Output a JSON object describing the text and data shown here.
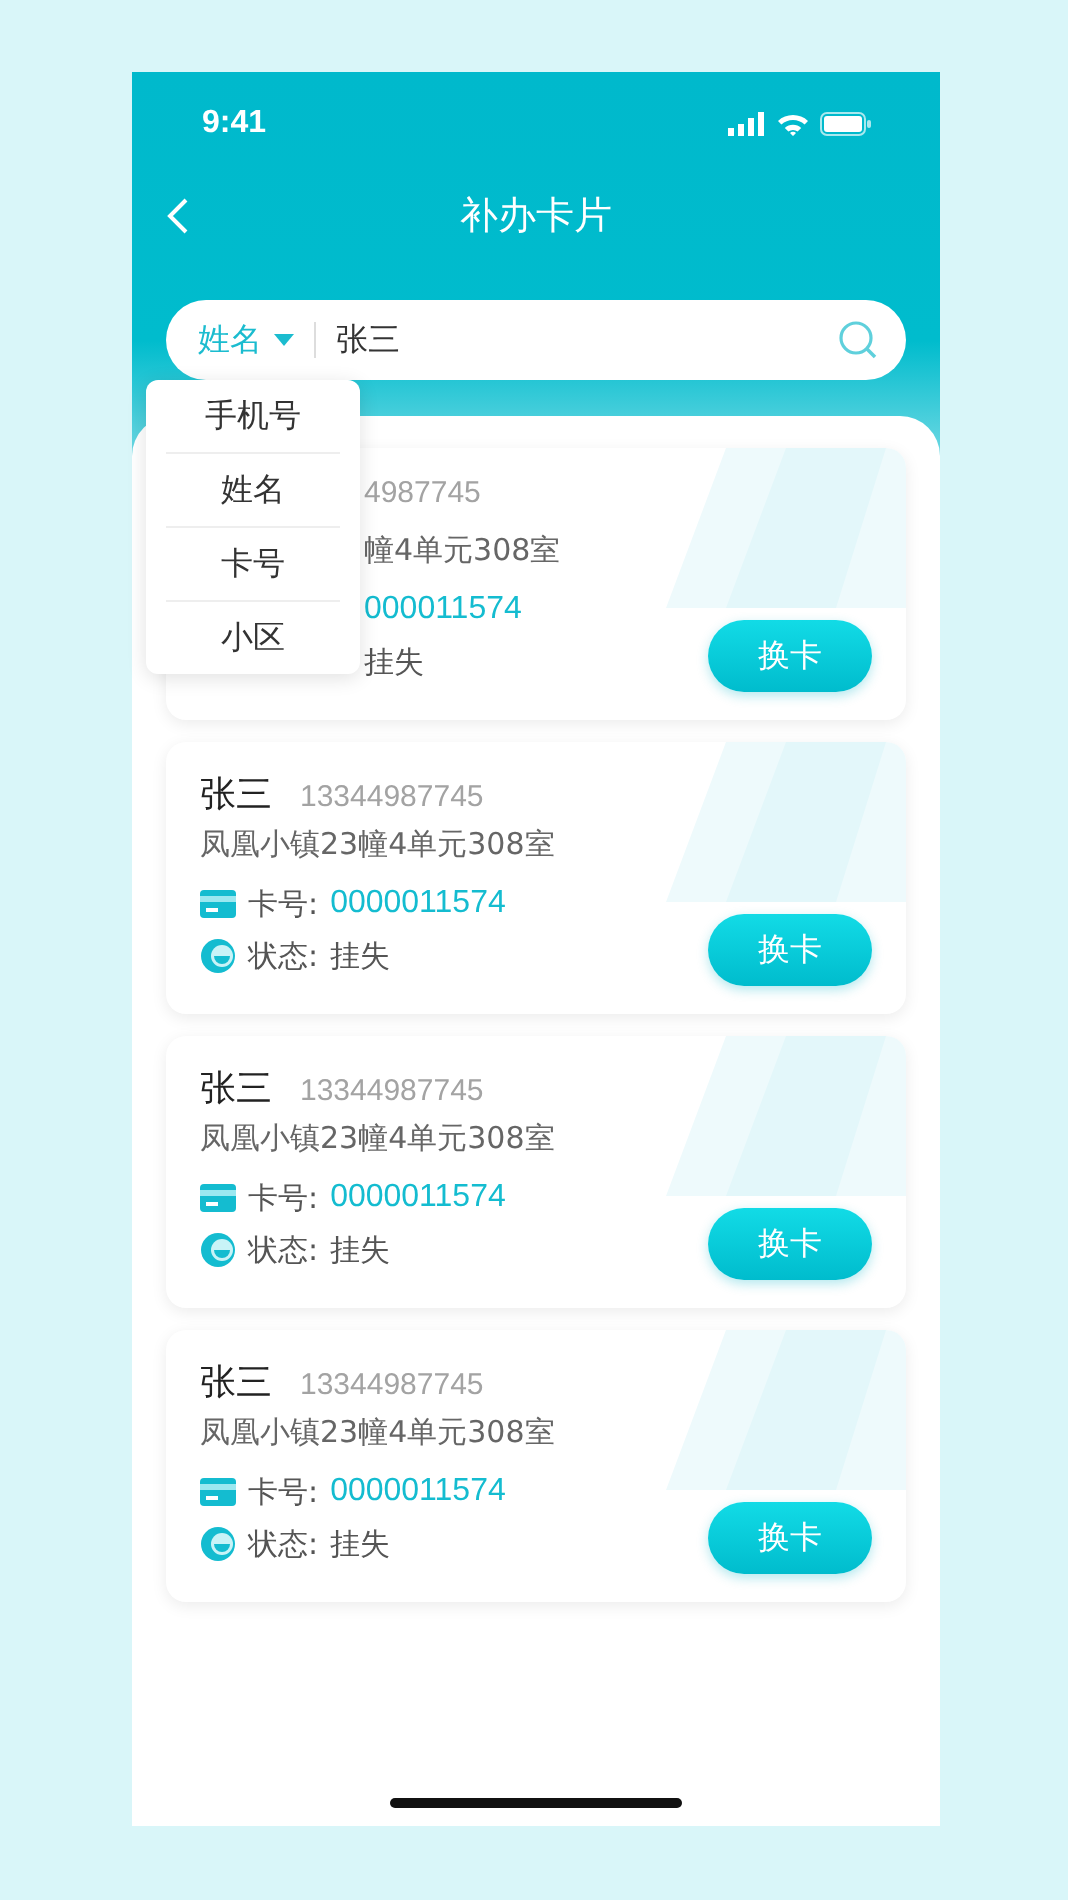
{
  "status_bar": {
    "time": "9:41"
  },
  "header": {
    "title": "补办卡片"
  },
  "search": {
    "filter": "姓名",
    "value": "张三"
  },
  "dropdown": {
    "items": [
      "手机号",
      "姓名",
      "卡号",
      "小区"
    ]
  },
  "cards": [
    {
      "covered": true,
      "phone": "4987745",
      "address": "幢4单元308室",
      "card_no": "000011574",
      "status": "挂失",
      "button": "换卡"
    },
    {
      "covered": false,
      "name": "张三",
      "phone": "13344987745",
      "address": "凤凰小镇23幢4单元308室",
      "card_label": "卡号:",
      "card_no": "0000011574",
      "status_label": "状态:",
      "status": "挂失",
      "button": "换卡"
    },
    {
      "covered": false,
      "name": "张三",
      "phone": "13344987745",
      "address": "凤凰小镇23幢4单元308室",
      "card_label": "卡号:",
      "card_no": "0000011574",
      "status_label": "状态:",
      "status": "挂失",
      "button": "换卡"
    },
    {
      "covered": false,
      "name": "张三",
      "phone": "13344987745",
      "address": "凤凰小镇23幢4单元308室",
      "card_label": "卡号:",
      "card_no": "0000011574",
      "status_label": "状态:",
      "status": "挂失",
      "button": "换卡"
    }
  ]
}
